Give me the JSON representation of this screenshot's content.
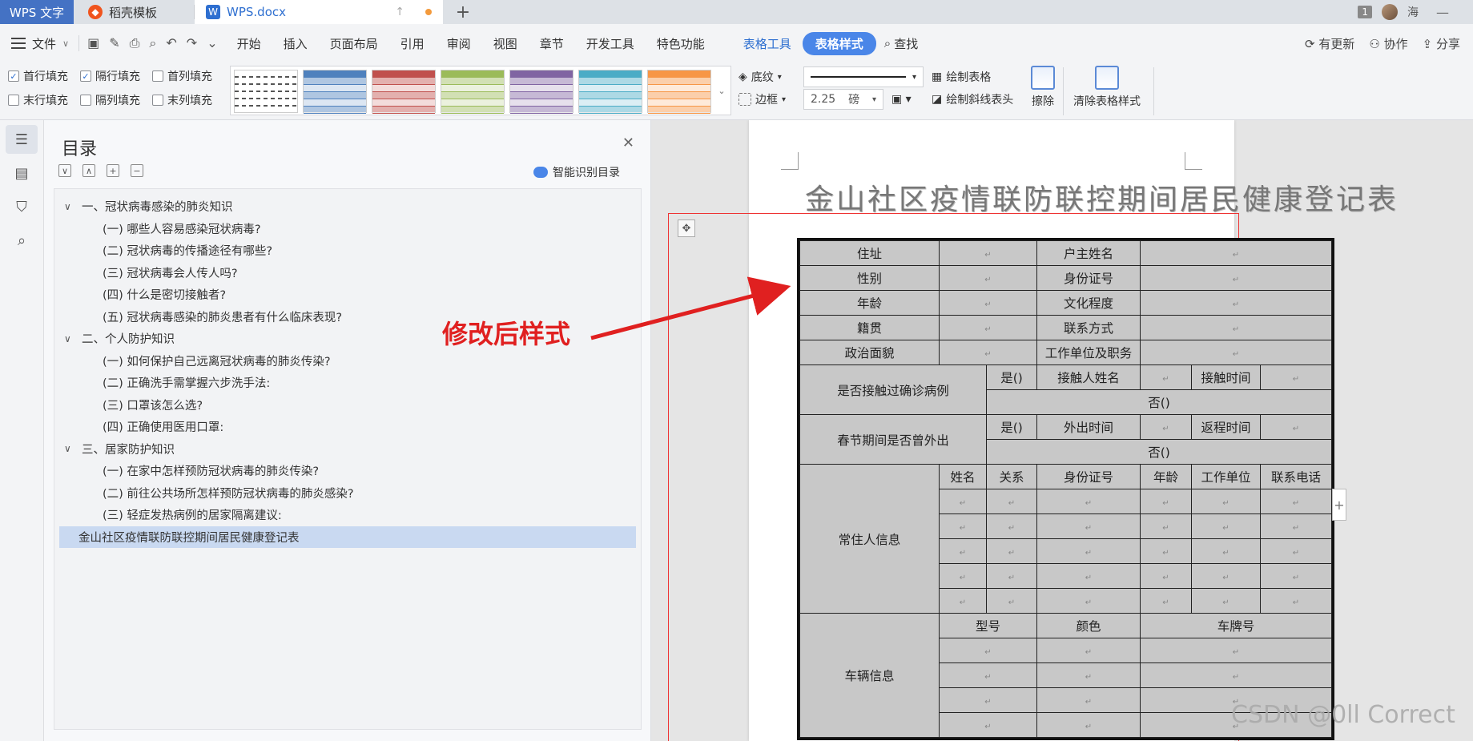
{
  "titlebar": {
    "app_tab": "WPS 文字",
    "tabs": [
      {
        "label": "稻壳模板"
      },
      {
        "label": "WPS.docx"
      }
    ],
    "count_badge": "1",
    "user": "海"
  },
  "menubar": {
    "file": "文件",
    "items": [
      "开始",
      "插入",
      "页面布局",
      "引用",
      "审阅",
      "视图",
      "章节",
      "开发工具",
      "特色功能"
    ],
    "context_tabs": [
      "表格工具",
      "表格样式"
    ],
    "search": "查找",
    "right": [
      "有更新",
      "协作",
      "分享"
    ]
  },
  "ribbon": {
    "checkboxes": [
      {
        "label": "首行填充",
        "checked": true
      },
      {
        "label": "隔行填充",
        "checked": true
      },
      {
        "label": "首列填充",
        "checked": false
      },
      {
        "label": "末行填充",
        "checked": false
      },
      {
        "label": "隔列填充",
        "checked": false
      },
      {
        "label": "末列填充",
        "checked": false
      }
    ],
    "style_colors": [
      "#4f81bd",
      "#c0504d",
      "#9bbb59",
      "#8064a2",
      "#4bacc6",
      "#f79646"
    ],
    "shading": "底纹",
    "border": "边框",
    "line_width": "2.25",
    "line_unit": "磅",
    "draw_table": "绘制表格",
    "draw_diagonal": "绘制斜线表头",
    "erase": "擦除",
    "clear_style": "清除表格样式"
  },
  "toc": {
    "title": "目录",
    "smart": "智能识别目录",
    "items": [
      {
        "level": 1,
        "label": "一、冠状病毒感染的肺炎知识"
      },
      {
        "level": 2,
        "label": "(一) 哪些人容易感染冠状病毒?"
      },
      {
        "level": 2,
        "label": "(二) 冠状病毒的传播途径有哪些?"
      },
      {
        "level": 2,
        "label": "(三) 冠状病毒会人传人吗?"
      },
      {
        "level": 2,
        "label": "(四) 什么是密切接触者?"
      },
      {
        "level": 2,
        "label": "(五) 冠状病毒感染的肺炎患者有什么临床表现?"
      },
      {
        "level": 1,
        "label": "二、个人防护知识"
      },
      {
        "level": 2,
        "label": "(一) 如何保护自己远离冠状病毒的肺炎传染?"
      },
      {
        "level": 2,
        "label": "(二) 正确洗手需掌握六步洗手法:"
      },
      {
        "level": 2,
        "label": "(三) 口罩该怎么选?"
      },
      {
        "level": 2,
        "label": "(四) 正确使用医用口罩:"
      },
      {
        "level": 1,
        "label": "三、居家防护知识"
      },
      {
        "level": 2,
        "label": "(一) 在家中怎样预防冠状病毒的肺炎传染?"
      },
      {
        "level": 2,
        "label": "(二) 前往公共场所怎样预防冠状病毒的肺炎感染?"
      },
      {
        "level": 2,
        "label": "(三) 轻症发热病例的居家隔离建议:"
      },
      {
        "level": 0,
        "label": "金山社区疫情联防联控期间居民健康登记表"
      }
    ]
  },
  "doc": {
    "title": "金山社区疫情联防联控期间居民健康登记表",
    "table": {
      "address": "住址",
      "householder": "户主姓名",
      "gender": "性别",
      "id_no": "身份证号",
      "age": "年龄",
      "education": "文化程度",
      "origin": "籍贯",
      "contact": "联系方式",
      "politics": "政治面貌",
      "work": "工作单位及职务",
      "contact_case": "是否接触过确诊病例",
      "yes": "是()",
      "contact_name": "接触人姓名",
      "contact_time": "接触时间",
      "no": "否()",
      "spring_out": "春节期间是否曾外出",
      "out_time": "外出时间",
      "return_time": "返程时间",
      "resident_info": "常住人信息",
      "res_headers": [
        "姓名",
        "关系",
        "身份证号",
        "年龄",
        "工作单位",
        "联系电话"
      ],
      "vehicle_info": "车辆信息",
      "veh_headers": [
        "型号",
        "颜色",
        "车牌号"
      ]
    }
  },
  "annotation": "修改后样式",
  "watermark": "CSDN @0ll Correct"
}
